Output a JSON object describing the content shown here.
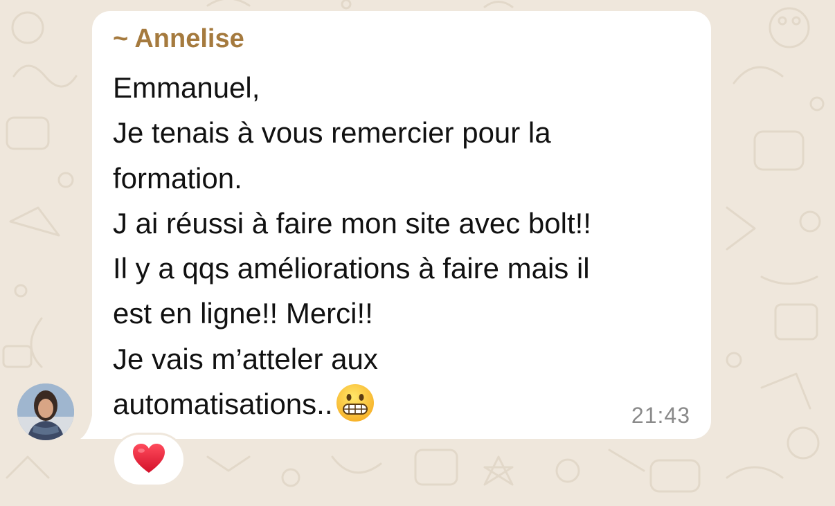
{
  "message": {
    "sender": "~ Annelise",
    "lines": [
      "Emmanuel,",
      "Je tenais à vous remercier pour la",
      "formation.",
      "J ai réussi à faire mon site avec bolt!!",
      "Il y a qqs améliorations à faire mais il",
      "est en ligne!! Merci!!",
      "Je vais m’atteler aux",
      "automatisations.."
    ],
    "trailing_emoji": "grimacing-face-emoji",
    "time": "21:43"
  },
  "reactions": [
    {
      "icon": "red-heart-icon"
    }
  ],
  "colors": {
    "background": "#efe7dc",
    "bubble": "#ffffff",
    "sender_name": "#a57a3e",
    "text": "#111111",
    "timestamp": "#8a8a8a",
    "heart": "#e8162b"
  }
}
